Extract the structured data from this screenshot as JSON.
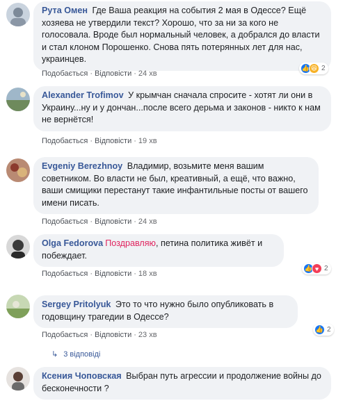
{
  "comments": [
    {
      "author": "Рута Омен",
      "text": "Где Ваша реакция на события 2 мая в Одессе? Ещё хозяева не утвердили текст? Хорошо, что за ни за кого не голосовала. Вроде был нормальный человек, а добрался до власти и стал клоном Порошенко. Снова пять потерянных лет для нас, украинцев.",
      "like": "Подобається",
      "reply": "Відповісти",
      "time": "24 хв",
      "reaction_count": "2"
    },
    {
      "author": "Alexander Trofimov",
      "text": "У крымчан сначала спросите - хотят ли они в Украину...ну и у дончан...после всего дерьма и законов - никто к нам не вернётся!",
      "like": "Подобається",
      "reply": "Відповісти",
      "time": "19 хв"
    },
    {
      "author": "Evgeniy Berezhnoy",
      "text": "Владимир, возьмите меня вашим советником. Во власти не был, креативный, а ещё, что важно, ваши смищики перестанут такие инфантильные посты от вашего имени писать.",
      "like": "Подобається",
      "reply": "Відповісти",
      "time": "24 хв"
    },
    {
      "author": "Olga Fedorova",
      "mention": "Поздравляю",
      "text": ", петина политика живёт и побеждает.",
      "like": "Подобається",
      "reply": "Відповісти",
      "time": "18 хв",
      "reaction_count": "2"
    },
    {
      "author": "Sergey Pritolyuk",
      "text": "Это то что нужно было опубликовать в годовщину трагедии в Одессе?",
      "like": "Подобається",
      "reply": "Відповісти",
      "time": "23 хв",
      "reaction_count": "2"
    },
    {
      "author": "Ксения Чоповская",
      "text": "Выбран путь агрессии и продолжение войны до бесконечности ?"
    }
  ],
  "replies_link": "3 відповіді",
  "colors": {
    "author": "#385898",
    "mention": "#e0245e",
    "bubble": "#f0f2f5",
    "like_blue": "#1877f2"
  }
}
